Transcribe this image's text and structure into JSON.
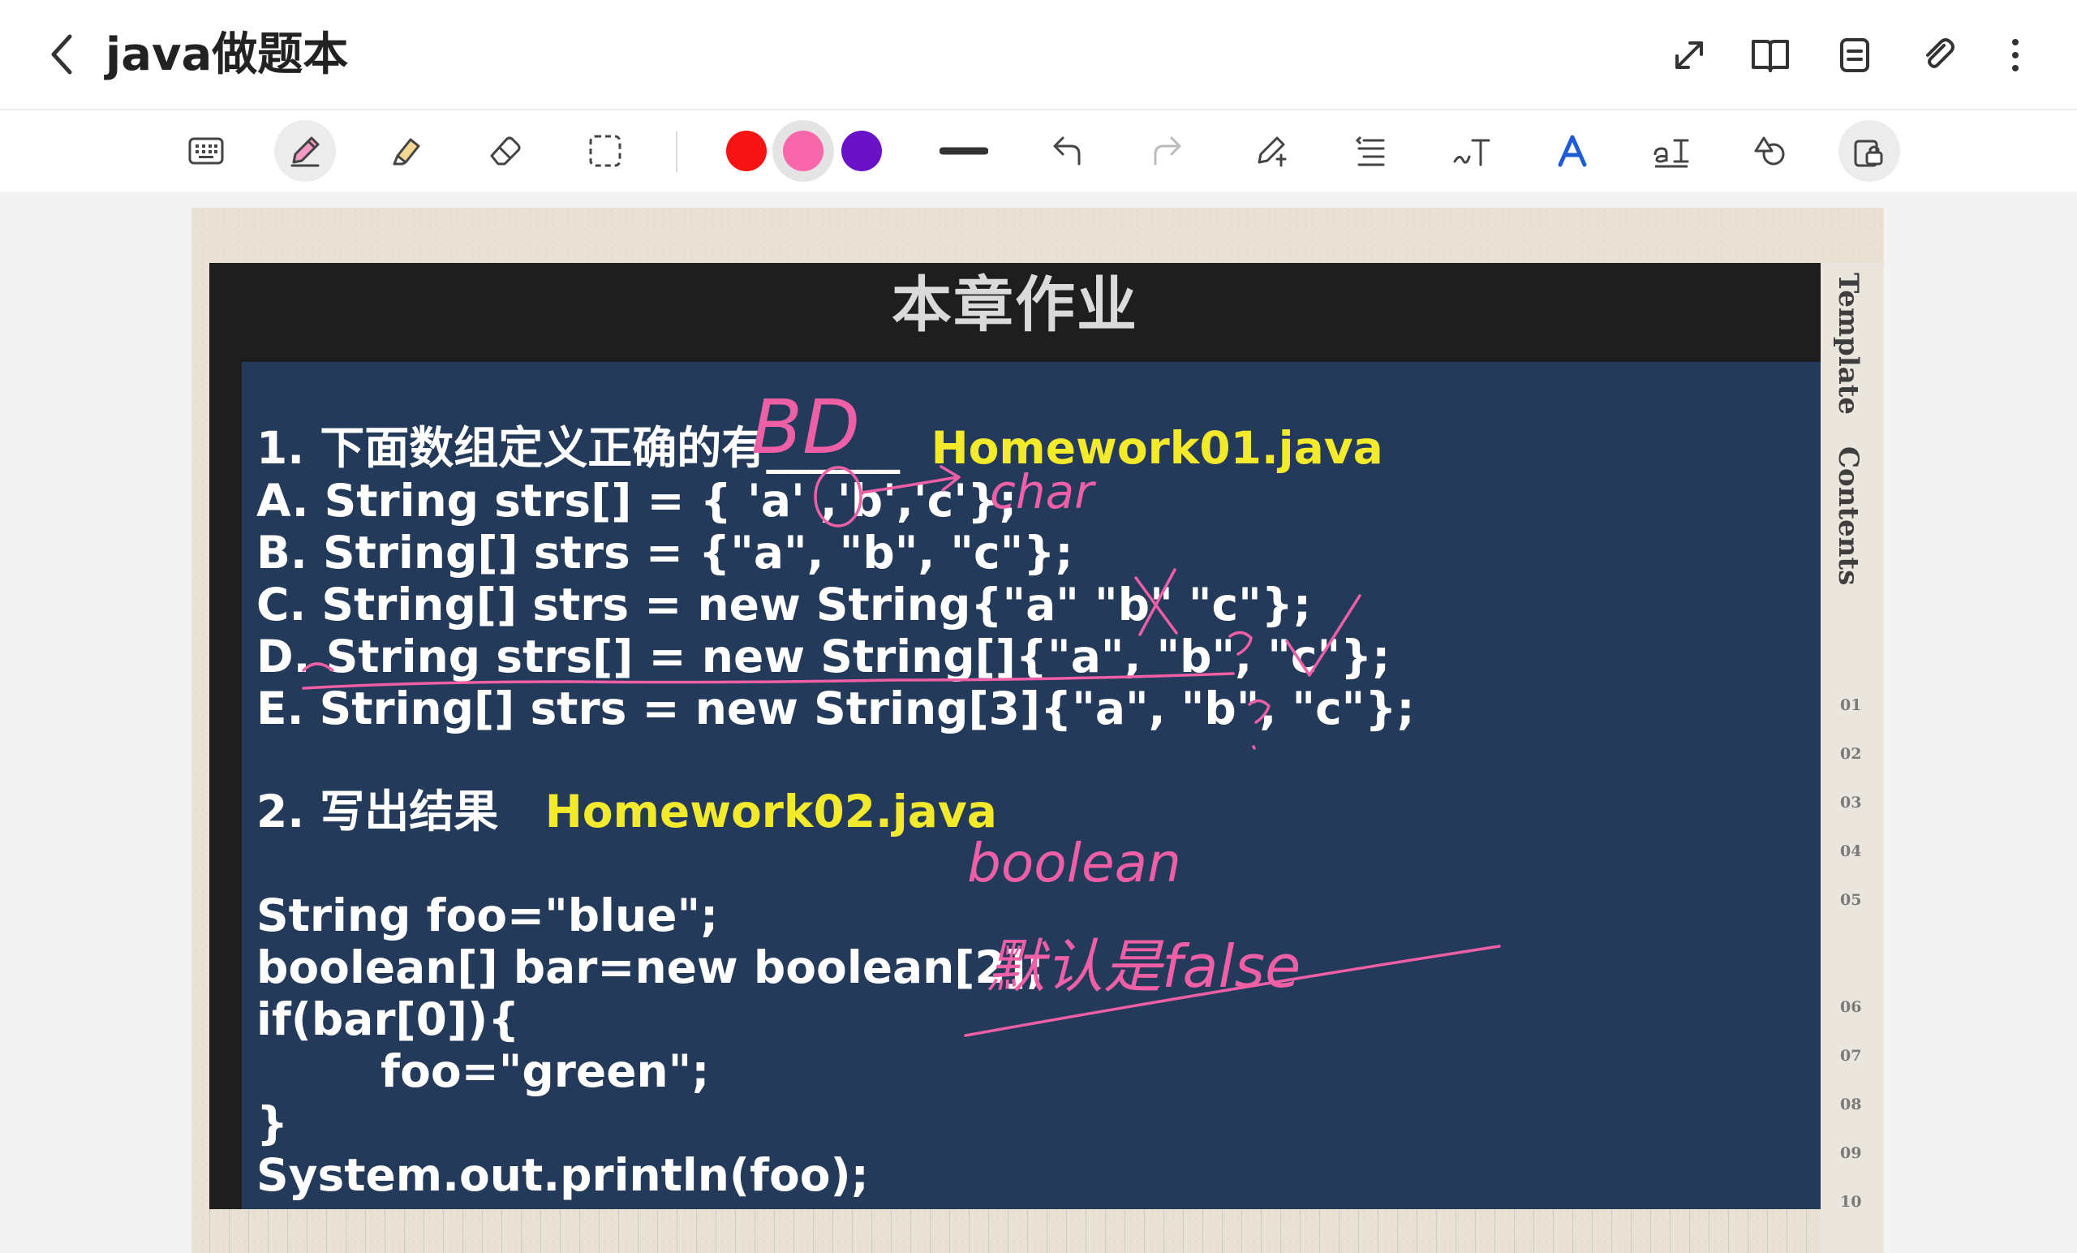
{
  "header": {
    "title": "java做题本",
    "icons": [
      "back-arrow-icon",
      "expand-icon",
      "book-view-icon",
      "page-list-icon",
      "attachment-icon",
      "more-icon"
    ]
  },
  "toolbar": {
    "tools": [
      "keyboard-icon",
      "pen-icon",
      "highlighter-icon",
      "eraser-icon",
      "selection-icon",
      "red-swatch",
      "pink-swatch",
      "purple-swatch",
      "line-width-icon",
      "undo-icon",
      "redo-icon",
      "shape-pen-icon",
      "text-align-icon",
      "handwriting-text-icon",
      "text-style-icon",
      "text-size-icon",
      "shapes-icon",
      "lock-icon"
    ],
    "colors": {
      "red": "#f61314",
      "pink": "#f767a9",
      "purple": "#6a12c7"
    },
    "active_tool": "pen",
    "selected_color": "pink"
  },
  "slide": {
    "title": "本章作业",
    "q1_prefix": "1. 下面数组定义正确的有",
    "q1_file": "Homework01.java",
    "q1_options": [
      "A. String strs[] = { 'a' ,'b','c'};",
      "B. String[] strs = {\"a\", \"b\", \"c\"};",
      "C. String[] strs = new String{\"a\" \"b\" \"c\"};",
      "D. String strs[] = new String[]{\"a\", \"b\", \"c\"};",
      "E. String[] strs = new String[3]{\"a\", \"b\", \"c\"};"
    ],
    "q2_prefix": "2. 写出结果",
    "q2_file": "Homework02.java",
    "q2_code": [
      "String foo=\"blue\";",
      "boolean[] bar=new boolean[2];",
      "if(bar[0]){",
      "        foo=\"green\";",
      "}",
      "System.out.println(foo);"
    ]
  },
  "handwriting": {
    "answer": "BD",
    "note_char": "char",
    "note_boolean": "boolean",
    "note_default": "默认是false",
    "ink_color": "#ee5fa6"
  },
  "side_tab": {
    "label_template": "Template",
    "label_contents": "Contents",
    "numbers": [
      "01",
      "02",
      "03",
      "04",
      "05",
      "06",
      "07",
      "08",
      "09",
      "10"
    ]
  }
}
